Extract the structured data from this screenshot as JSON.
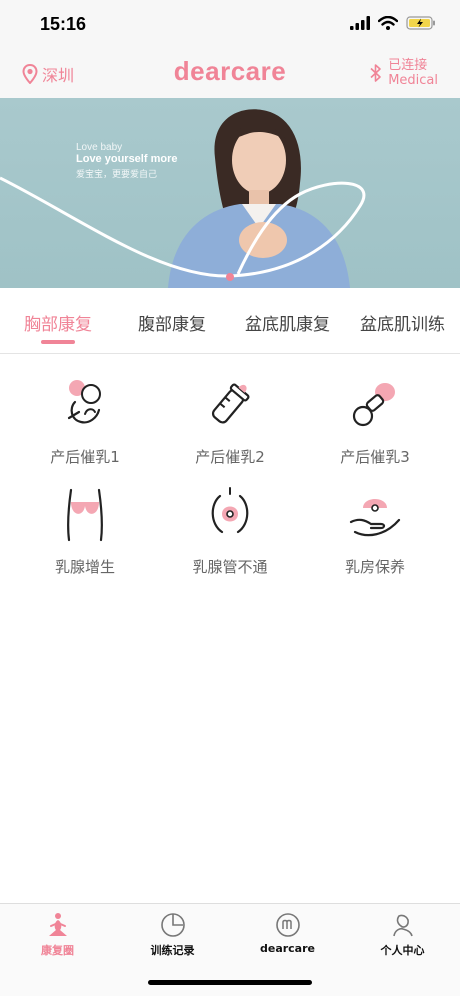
{
  "status_bar": {
    "time": "15:16",
    "icons": [
      "signal-icon",
      "wifi-icon",
      "battery-icon"
    ]
  },
  "header": {
    "location": "深圳",
    "brand": "dearcare",
    "connection_status": "已连接",
    "device_name": "Medical",
    "icons": [
      "location-pin-icon",
      "bluetooth-icon"
    ]
  },
  "banner": {
    "line1": "Love baby",
    "line2": "Love yourself more",
    "line3": "爱宝宝，更要爱自己"
  },
  "tabs": [
    {
      "label": "胸部康复",
      "active": true
    },
    {
      "label": "腹部康复",
      "active": false
    },
    {
      "label": "盆底肌康复",
      "active": false
    },
    {
      "label": "盆底肌训练",
      "active": false
    }
  ],
  "programs": [
    {
      "label": "产后催乳1",
      "icon": "baby-icon"
    },
    {
      "label": "产后催乳2",
      "icon": "baby-bottle-icon"
    },
    {
      "label": "产后催乳3",
      "icon": "pacifier-icon"
    },
    {
      "label": "乳腺增生",
      "icon": "chest-icon"
    },
    {
      "label": "乳腺管不通",
      "icon": "breast-duct-icon"
    },
    {
      "label": "乳房保养",
      "icon": "hand-care-icon"
    }
  ],
  "tabbar": [
    {
      "label": "康复圈",
      "icon": "yoga-icon",
      "active": true
    },
    {
      "label": "训练记录",
      "icon": "pie-chart-icon",
      "active": false
    },
    {
      "label": "dearcare",
      "icon": "brand-m-icon",
      "active": false
    },
    {
      "label": "个人中心",
      "icon": "profile-icon",
      "active": false
    }
  ],
  "colors": {
    "accent": "#f08497",
    "banner_bg": "#a9c9cd",
    "text": "#333333"
  }
}
